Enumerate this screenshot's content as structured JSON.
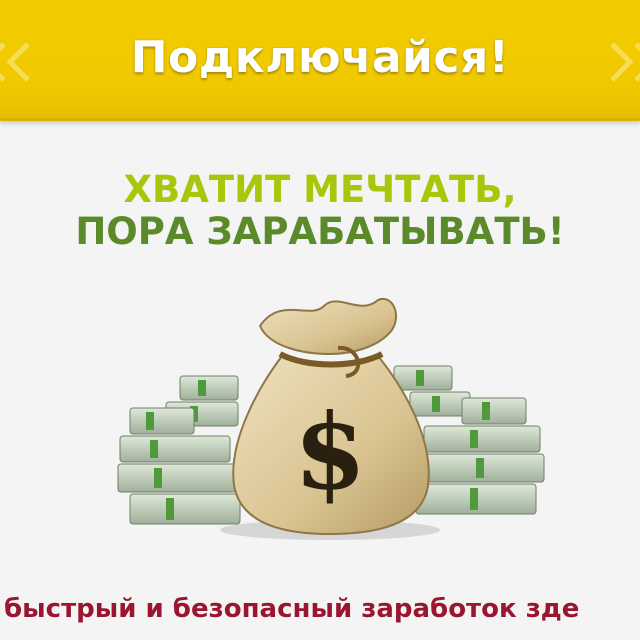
{
  "banner": {
    "title": "Подключайся!",
    "color": "#f0c800"
  },
  "headline": {
    "line1": "ХВАТИТ МЕЧТАТЬ,",
    "line2": "ПОРА ЗАРАБАТЫВАТЬ!",
    "line1_color": "#a8c60a",
    "line2_color": "#5a8a2a"
  },
  "illustration": {
    "icon": "money-bag-icon",
    "symbol": "$"
  },
  "footer": {
    "text": "быстрый и безопасный заработок зде",
    "color": "#9a1530"
  }
}
